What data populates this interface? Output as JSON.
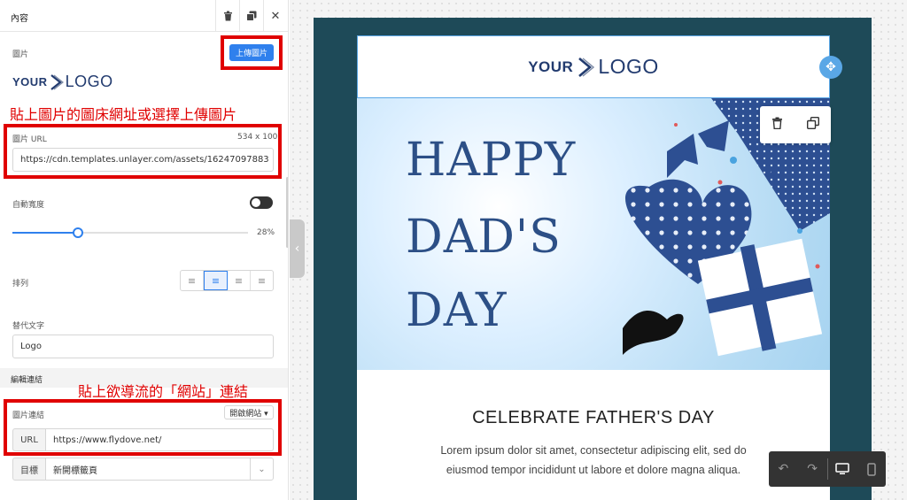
{
  "panel": {
    "title": "內容",
    "image_label": "圖片",
    "upload_label": "上傳圖片",
    "image_url_label": "圖片 URL",
    "image_dims": "534 x 100",
    "image_url_value": "https://cdn.templates.unlayer.com/assets/16247097883",
    "auto_width_label": "自動寬度",
    "width_percent_text": "28%",
    "width_fraction": 0.28,
    "align_label": "排列",
    "alt_label": "替代文字",
    "alt_value": "Logo",
    "link_section_label": "編輯連結",
    "image_link_label": "圖片連結",
    "link_type": "開啟網站 ▾",
    "url_addon": "URL",
    "url_value": "https://www.flydove.net/",
    "target_addon": "目標",
    "target_value": "新開標籤頁"
  },
  "annotations": {
    "note1": "貼上圖片的圖床網址或選擇上傳圖片",
    "note2": "貼上欲導流的「網站」連結",
    "color": "#e00000"
  },
  "logo": {
    "your": "YOUR",
    "logo": "LOGO"
  },
  "email": {
    "hero_line1": "HAPPY",
    "hero_line2": "DAD'S",
    "hero_line3": "DAY",
    "heading": "CELEBRATE FATHER'S DAY",
    "para_line1": "Lorem ipsum dolor sit amet, consectetur adipiscing elit, sed do",
    "para_line2": "eiusmod tempor incididunt ut labore et dolore magna aliqua."
  },
  "icons": {
    "trash": "trash-icon",
    "duplicate": "duplicate-icon",
    "close": "close-icon",
    "move": "move-icon",
    "undo": "undo-icon",
    "redo": "redo-icon",
    "desktop": "desktop-icon",
    "mobile": "mobile-icon"
  },
  "colors": {
    "accent": "#2f80ed",
    "email_background": "#1e4a58",
    "hero_text": "#2c4f86",
    "selection": "#5aa7e6"
  }
}
